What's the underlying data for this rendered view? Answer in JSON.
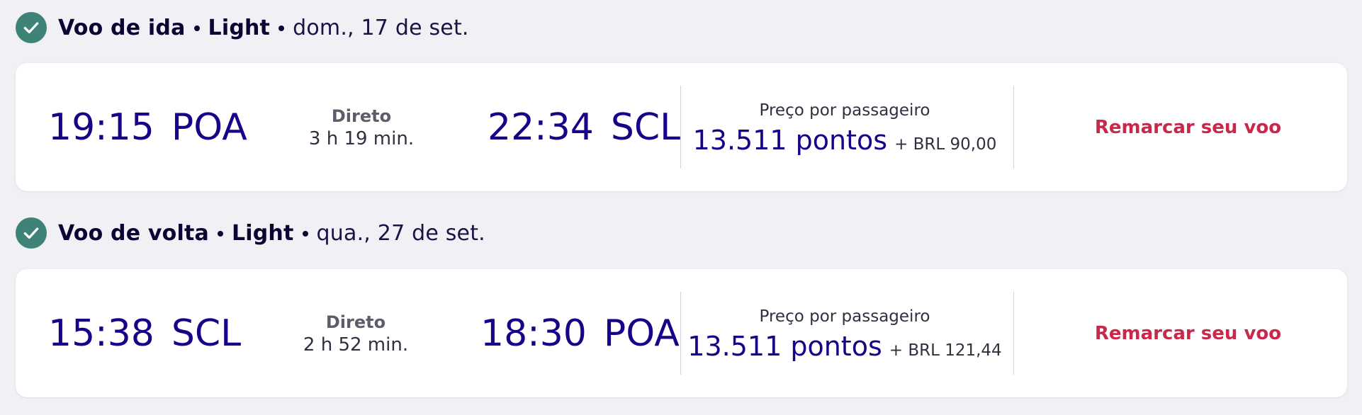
{
  "outbound": {
    "heading": "Voo de ida",
    "fare": "Light",
    "date": "dom., 17 de set.",
    "depart_time": "19:15",
    "depart_airport": "POA",
    "stops": "Direto",
    "duration": "3 h 19 min.",
    "arrive_time": "22:34",
    "arrive_airport": "SCL",
    "price_label": "Preço por passageiro",
    "price_points": "13.511 pontos",
    "price_extra": "+ BRL 90,00",
    "action_label": "Remarcar seu voo"
  },
  "inbound": {
    "heading": "Voo de volta",
    "fare": "Light",
    "date": "qua., 27 de set.",
    "depart_time": "15:38",
    "depart_airport": "SCL",
    "stops": "Direto",
    "duration": "2 h 52 min.",
    "arrive_time": "18:30",
    "arrive_airport": "POA",
    "price_label": "Preço por passageiro",
    "price_points": "13.511 pontos",
    "price_extra": "+ BRL 121,44",
    "action_label": "Remarcar seu voo"
  },
  "icons": {
    "check": "check-circle-icon"
  },
  "colors": {
    "background": "#f1f0f5",
    "primary": "#1b0088",
    "accent_action": "#c8294b",
    "check_circle": "#3d8378"
  }
}
